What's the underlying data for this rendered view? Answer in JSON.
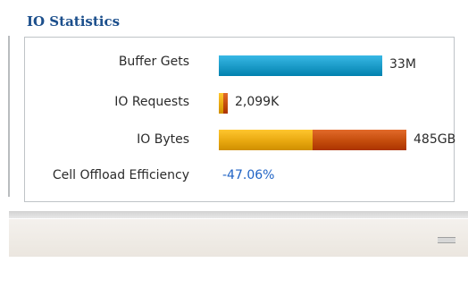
{
  "section": {
    "title": "IO Statistics"
  },
  "stats": [
    {
      "label": "Buffer Gets",
      "value": "33M",
      "segments": [
        {
          "fraction": 0.59,
          "color": "#1a9ac7"
        }
      ]
    },
    {
      "label": "IO Requests",
      "value": "2,099K",
      "segments": [
        {
          "fraction": 0.016,
          "color": "#e8a810"
        },
        {
          "fraction": 0.016,
          "color": "#c44c0c"
        }
      ]
    },
    {
      "label": "IO Bytes",
      "value": "485GB",
      "segments": [
        {
          "fraction": 0.34,
          "color": "#e8a810"
        },
        {
          "fraction": 0.34,
          "color": "#c44c0c"
        }
      ]
    }
  ],
  "efficiency": {
    "label": "Cell Offload Efficiency",
    "value": "-47.06%"
  },
  "colors": {
    "title": "#1c4f8c",
    "efficiency_value": "#1f63c5"
  },
  "icons": {
    "collapse": "collapse-handle-icon"
  }
}
